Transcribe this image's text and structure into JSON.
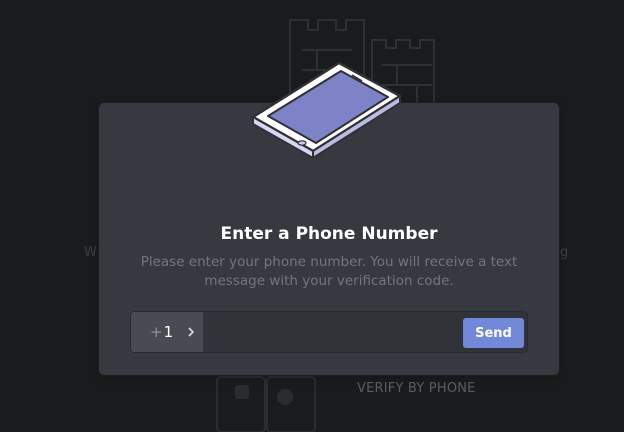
{
  "background": {
    "left_text": "W",
    "right_text": "g",
    "verify_label": "VERIFY BY PHONE",
    "icons": [
      "castle-illustration",
      "android-icon",
      "apple-icon"
    ]
  },
  "modal": {
    "title": "Enter a Phone Number",
    "description": "Please enter your phone number. You will receive a text message with your verification code.",
    "country": {
      "plus": "+",
      "code": "1"
    },
    "phone_value": "",
    "send_label": "Send",
    "illustration_icon": "phone-illustration",
    "colors": {
      "modal_bg": "#36393f",
      "accent": "#7289da",
      "input_bg": "#303338"
    }
  }
}
